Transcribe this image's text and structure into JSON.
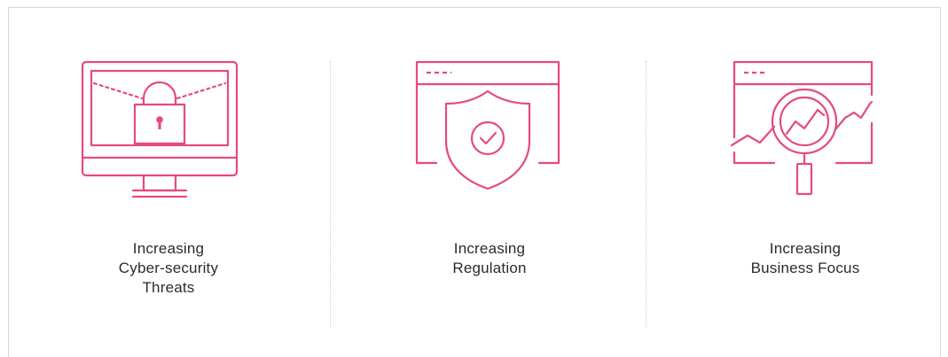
{
  "colors": {
    "accent": "#e64a7c",
    "text": "#2b2b2b",
    "border": "#d6d6d6",
    "divider": "#c9c9c9"
  },
  "items": [
    {
      "icon": "monitor-lock-icon",
      "label_lines": [
        "Increasing",
        "Cyber-security",
        "Threats"
      ]
    },
    {
      "icon": "browser-shield-check-icon",
      "label_lines": [
        "Increasing",
        "Regulation"
      ]
    },
    {
      "icon": "browser-magnifier-chart-icon",
      "label_lines": [
        "Increasing",
        "Business Focus"
      ]
    }
  ]
}
